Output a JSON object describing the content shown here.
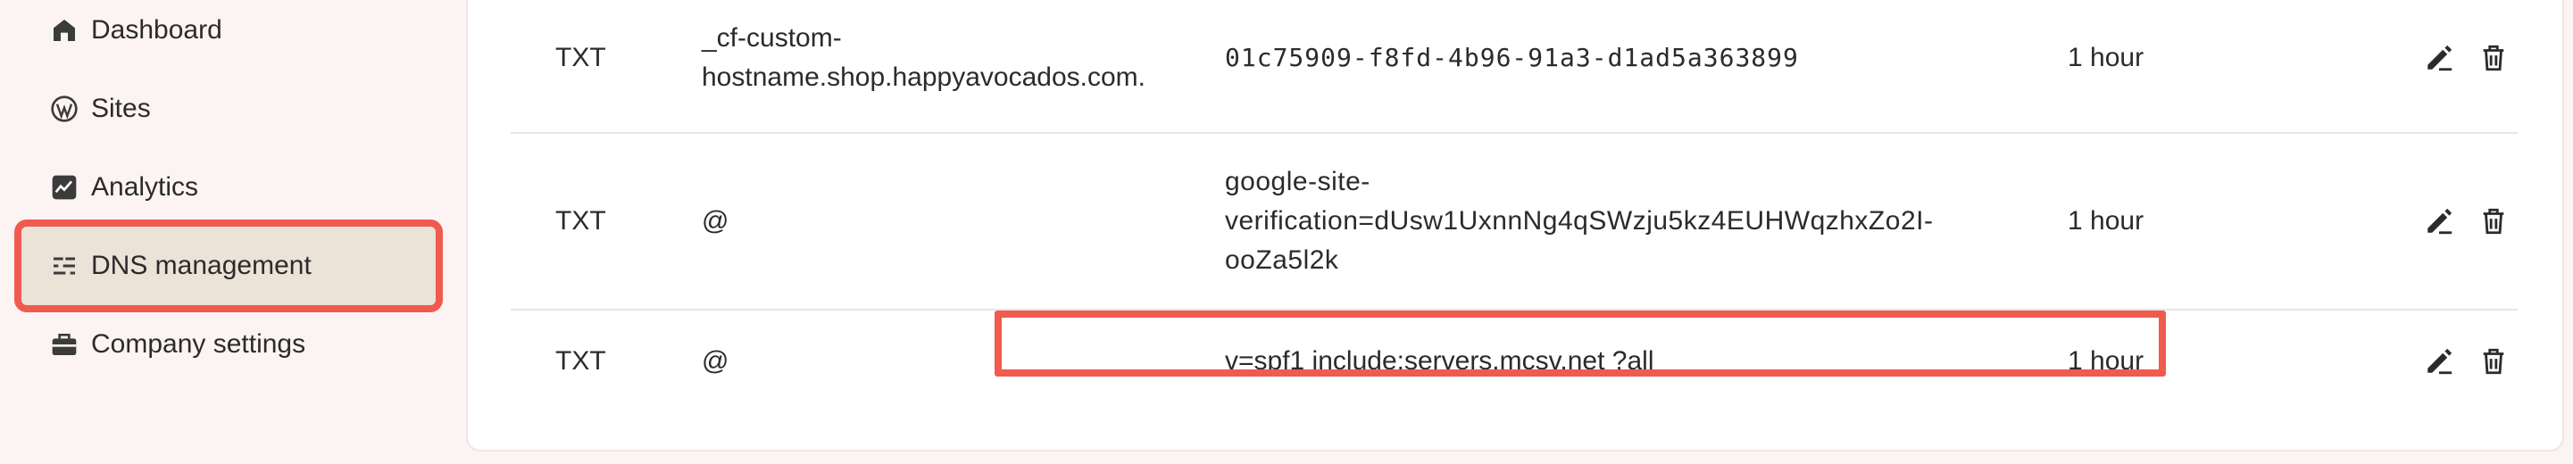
{
  "sidebar": {
    "items": [
      {
        "label": "Dashboard",
        "icon": "home-icon"
      },
      {
        "label": "Sites",
        "icon": "wordpress-icon"
      },
      {
        "label": "Analytics",
        "icon": "analytics-icon"
      },
      {
        "label": "DNS management",
        "icon": "dns-icon",
        "active": true
      },
      {
        "label": "Company settings",
        "icon": "briefcase-icon"
      }
    ]
  },
  "records": [
    {
      "type": "TXT",
      "name": "_cf-custom-\nhostname.shop.happyavocados.com.",
      "value": "01c75909-f8fd-4b96-91a3-d1ad5a363899",
      "ttl": "1 hour"
    },
    {
      "type": "TXT",
      "name": "@",
      "value": "google-site-\nverification=dUsw1UxnnNg4qSWzju5kz4EUHWqzhxZo2I-\nooZa5l2k",
      "ttl": "1 hour"
    },
    {
      "type": "TXT",
      "name": "@",
      "value": "v=spf1 include:servers.mcsv.net ?all",
      "ttl": "1 hour"
    }
  ],
  "colors": {
    "accent": "#f15a4e",
    "active_bg": "#ebe2d8",
    "page_bg": "#fbf4f2"
  }
}
